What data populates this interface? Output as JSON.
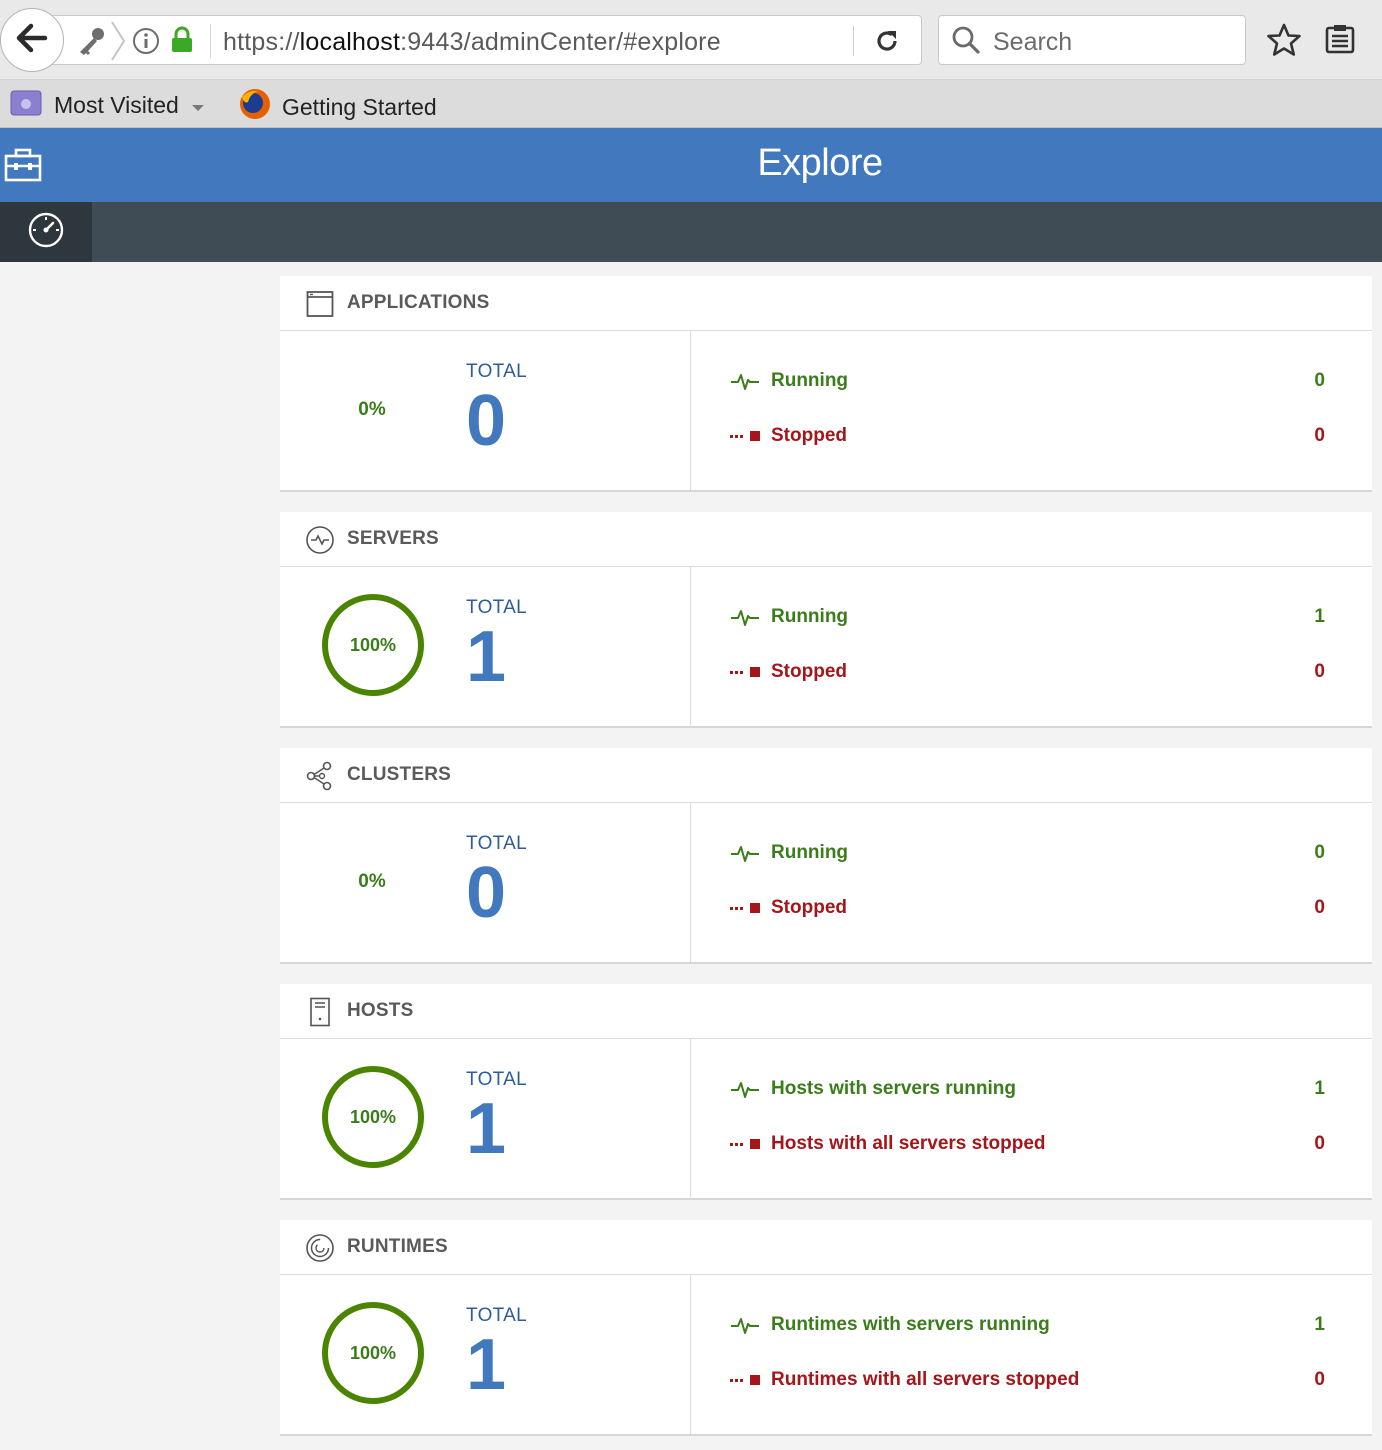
{
  "browser": {
    "url_scheme": "https://",
    "url_host": "localhost",
    "url_rest": ":9443/adminCenter/#explore",
    "search_placeholder": "Search",
    "bookmarks": [
      {
        "label": "Most Visited",
        "icon": "folder-icon"
      },
      {
        "label": "Getting Started",
        "icon": "firefox-icon"
      }
    ]
  },
  "app": {
    "title": "Explore",
    "icon": "toolbox-icon",
    "tab_icon": "dashboard-gauge-icon",
    "colors": {
      "header": "#4178be",
      "subheader": "#3f4c55",
      "running": "#3b7c1b",
      "stopped": "#a4161a",
      "total": "#4178be"
    }
  },
  "cards": [
    {
      "title": "APPLICATIONS",
      "icon": "application-window-icon",
      "percent": "0%",
      "percent_value": 0,
      "total_label": "TOTAL",
      "total": "0",
      "running_label": "Running",
      "running_value": "0",
      "stopped_label": "Stopped",
      "stopped_value": "0"
    },
    {
      "title": "SERVERS",
      "icon": "server-icon",
      "percent": "100%",
      "percent_value": 100,
      "total_label": "TOTAL",
      "total": "1",
      "running_label": "Running",
      "running_value": "1",
      "stopped_label": "Stopped",
      "stopped_value": "0"
    },
    {
      "title": "CLUSTERS",
      "icon": "cluster-icon",
      "percent": "0%",
      "percent_value": 0,
      "total_label": "TOTAL",
      "total": "0",
      "running_label": "Running",
      "running_value": "0",
      "stopped_label": "Stopped",
      "stopped_value": "0"
    },
    {
      "title": "HOSTS",
      "icon": "host-icon",
      "percent": "100%",
      "percent_value": 100,
      "total_label": "TOTAL",
      "total": "1",
      "running_label": "Hosts with servers running",
      "running_value": "1",
      "stopped_label": "Hosts with all servers stopped",
      "stopped_value": "0"
    },
    {
      "title": "RUNTIMES",
      "icon": "runtime-icon",
      "percent": "100%",
      "percent_value": 100,
      "total_label": "TOTAL",
      "total": "1",
      "running_label": "Runtimes with servers running",
      "running_value": "1",
      "stopped_label": "Runtimes with all servers stopped",
      "stopped_value": "0"
    }
  ]
}
